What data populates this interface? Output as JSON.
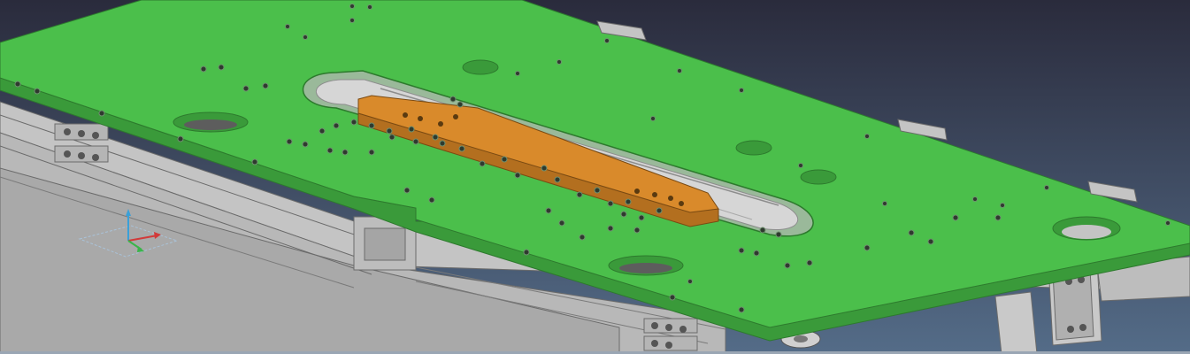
{
  "viewport": {
    "background_top": "#2a2b3c",
    "background_bottom": "#546c88"
  },
  "colors": {
    "plate_top": "#4bbf4b",
    "plate_side": "#3a9a3a",
    "plate_edge_line": "#2d7a2d",
    "insert": "#d98a2b",
    "insert_side": "#b36f1f",
    "frame": "#c4c4c4",
    "frame_shadow": "#8d8d8d",
    "frame_line": "#6b6b6b",
    "slot_cavity": "#d6d6d6",
    "hole": "#2e3a2e",
    "hole_rim": "#6f8f6f",
    "triad_x": "#d23a3a",
    "triad_y": "#3ab54a",
    "triad_z": "#3aa0d8",
    "triad_plane": "#a9c2d8"
  },
  "icons": {
    "triad": "axis-triad-icon",
    "model": "cad-assembly-model"
  }
}
